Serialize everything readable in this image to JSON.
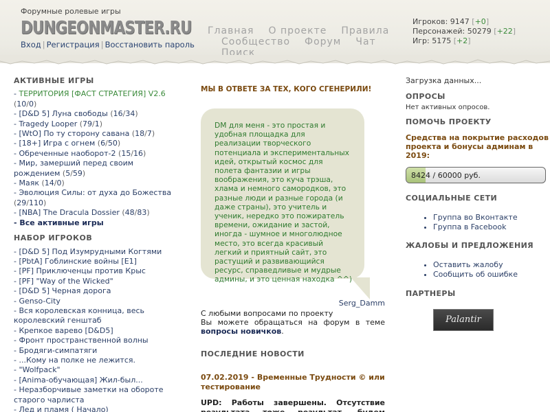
{
  "header": {
    "tagline": "Форумные ролевые игры",
    "logo": "DUNGEONMASTER.RU",
    "auth": {
      "login": "Вход",
      "register": "Регистрация",
      "restore": "Восстановить пароль"
    },
    "nav": {
      "main": "Главная",
      "about": "О проекте",
      "rules": "Правила",
      "community": "Сообщество",
      "forum": "Форум",
      "chat": "Чат",
      "search": "Поиск"
    },
    "stats": {
      "players_label": "Игроков:",
      "players": "9147",
      "players_plus": "+0",
      "chars_label": "Персонажей:",
      "chars": "50279",
      "chars_plus": "+22",
      "games_label": "Игр:",
      "games": "5175",
      "games_plus": "+2"
    }
  },
  "left": {
    "active_title": "АКТИВНЫЕ ИГРЫ",
    "active_games": [
      {
        "name": "ТЕРРИТОРИЯ [ФАСТ СТРАТЕГИЯ] V2.6",
        "a": "10",
        "b": "0",
        "highlight": true
      },
      {
        "name": "[D&D 5] Луна свободы",
        "a": "16",
        "b": "34"
      },
      {
        "name": "Tragedy Looper",
        "a": "79",
        "b": "1"
      },
      {
        "name": "[WtO] По ту сторону савана",
        "a": "18",
        "b": "7"
      },
      {
        "name": "[18+] Игра с огнем",
        "a": "6",
        "b": "50"
      },
      {
        "name": "Обреченные наоборот-2",
        "a": "15",
        "b": "16"
      },
      {
        "name": "Мир, замерший перед своим рождением",
        "a": "5",
        "b": "59"
      },
      {
        "name": "Маяк",
        "a": "14",
        "b": "0"
      },
      {
        "name": "Эволюция Силы: от духа до Божества",
        "a": "29",
        "b": "110"
      },
      {
        "name": "[NBA] The Dracula Dossier",
        "a": "48",
        "b": "83"
      }
    ],
    "all_active": "Все активные игры",
    "recruit_title": "НАБОР ИГРОКОВ",
    "recruit_games": [
      "[D&D 5] Под Изумрудными Когтями",
      "[PbtA] Гоблинские войны [E1]",
      "[PF] Приключенцы против Крыс",
      "[PF] \"Way of the Wicked\"",
      "[D&D 5] Черная дорога",
      "Genso-City",
      "Вся королевская конница, весь королевский генштаб",
      "Крепкое варево [D&D5]",
      "Фронт пространственной волны",
      "Бродяги-симпатяги",
      "...Кому на полке не лежится.",
      "\"Wolfpack\"",
      "[Anima-обучающая] Жил-был...",
      "Неразборчивые заметки на обороте старого чарлиста",
      "Лед и пламя ( Начало)"
    ]
  },
  "middle": {
    "slogan": "МЫ В ОТВЕТЕ ЗА ТЕХ, КОГО СГЕНЕРИЛИ!",
    "quote": "DM для меня - это простая и удобная площадка для реализации творческого потенциала и экспериментальных идей, открытый космос для полета фантазии и игры воображения, это куча трэша, хлама и немного самородков, это разные люди и разные города (и даже страны), это учитель и ученик, нередко это пожиратель времени, ожидание и застой, иногда - шумное и многолюдное место, это всегда красивый легкий и приятный сайт, это растущий и развивающийся ресурс, справедливые и мудрые админы, и это ценная находка ^^)",
    "author": "Serg_Damm",
    "ask_line1": "С любыми вопросами по проекту",
    "ask_line2": "Вы можете обращаться на форум в теме",
    "ask_link": "вопросы новичков",
    "news_title": "ПОСЛЕДНИЕ НОВОСТИ",
    "news_item_title": "07.02.2019 - Временные Трудности © или тестирование",
    "news_item_body": "UPD: Работы завершены. Отсутствие результата тоже результат, будем думать дальше."
  },
  "right": {
    "loading": "Загрузка данных...",
    "polls_title": "ОПРОСЫ",
    "polls_empty": "Нет активных опросов.",
    "help_title": "ПОМОЧЬ ПРОЕКТУ",
    "fund_text": "Средства на покрытие расходов проекта и бонусы админам в 2019:",
    "fund_value": "8424",
    "fund_goal": "60000 руб.",
    "fund_fraction": 0.14,
    "social_title": "СОЦИАЛЬНЫЕ СЕТИ",
    "social_links": [
      "Группа во Вконтакте",
      "Группа в Facebook"
    ],
    "complaints_title": "ЖАЛОБЫ И ПРЕДЛОЖЕНИЯ",
    "complaint_links": [
      "Оставить жалобу",
      "Сообщить об ошибке"
    ],
    "partners_title": "ПАРТНЕРЫ",
    "partner_name": "Palantir"
  }
}
